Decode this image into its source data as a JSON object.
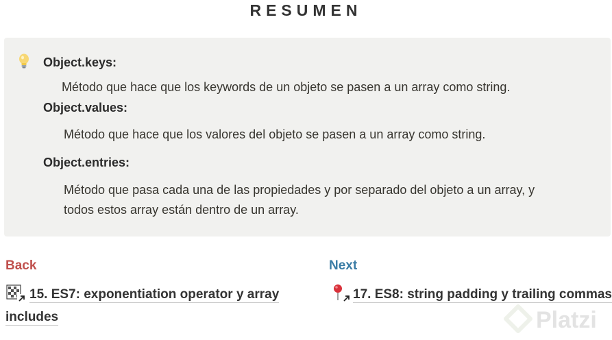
{
  "page": {
    "title": "RESUMEN"
  },
  "callout": {
    "icon": "light-bulb-icon",
    "items": [
      {
        "term": "Object.keys:",
        "description": "Método que hace que los keywords de un objeto se pasen a un array como string."
      },
      {
        "term": "Object.values:",
        "description": "Método que hace que los valores del objeto se pasen a un array como string."
      },
      {
        "term": "Object.entries:",
        "description_line1": "Método que pasa cada una de las propiedades y por separado del objeto a un array, y",
        "description_line2": "todos estos array están dentro de un array."
      }
    ]
  },
  "navigation": {
    "back": {
      "label": "Back",
      "link_line1": "15. ES7: exponentiation operator y array",
      "link_line2": "includes",
      "icon": "checkered-page-link-icon"
    },
    "next": {
      "label": "Next",
      "link": "17. ES8: string padding y trailing commas",
      "icon": "pushpin-link-icon"
    }
  },
  "watermark": {
    "text": "Platzi"
  },
  "colors": {
    "back": "#c0504d",
    "next": "#3a7ca5",
    "callout_bg": "#f1f1ef"
  }
}
